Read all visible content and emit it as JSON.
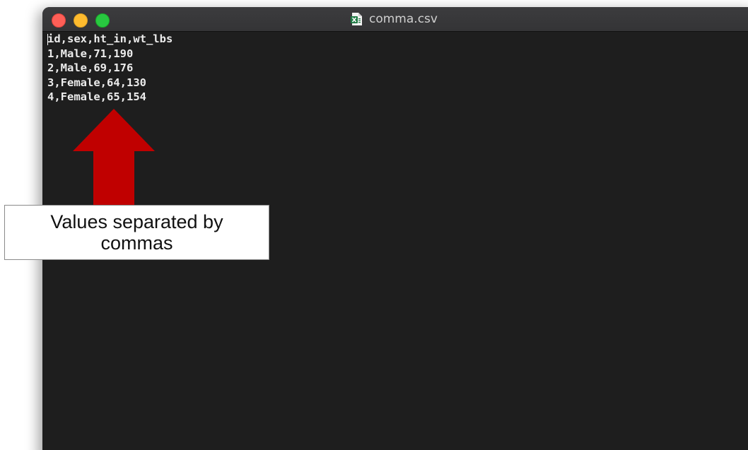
{
  "window": {
    "title": "comma.csv",
    "file_icon": "excel-file-icon"
  },
  "editor": {
    "lines": [
      "id,sex,ht_in,wt_lbs",
      "1,Male,71,190",
      "2,Male,69,176",
      "3,Female,64,130",
      "4,Female,65,154"
    ]
  },
  "annotation": {
    "text": "Values separated by commas",
    "arrow_color": "#c00000",
    "arrow_direction": "up"
  },
  "colors": {
    "editor_background": "#1e1e1e",
    "editor_text": "#ececec",
    "close": "#fe5f57",
    "minimize": "#febb2e",
    "maximize": "#28c840"
  }
}
